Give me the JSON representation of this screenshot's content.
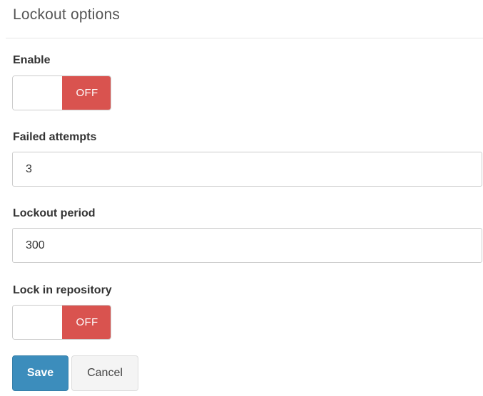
{
  "panel": {
    "title": "Lockout options"
  },
  "form": {
    "enable": {
      "label": "Enable",
      "state_label": "OFF"
    },
    "failed_attempts": {
      "label": "Failed attempts",
      "value": "3"
    },
    "lockout_period": {
      "label": "Lockout period",
      "value": "300"
    },
    "lock_in_repository": {
      "label": "Lock in repository",
      "state_label": "OFF"
    }
  },
  "actions": {
    "save_label": "Save",
    "cancel_label": "Cancel"
  },
  "colors": {
    "off_toggle": "#d9534f",
    "primary_button": "#3c8dbc",
    "default_button": "#f4f4f4"
  }
}
